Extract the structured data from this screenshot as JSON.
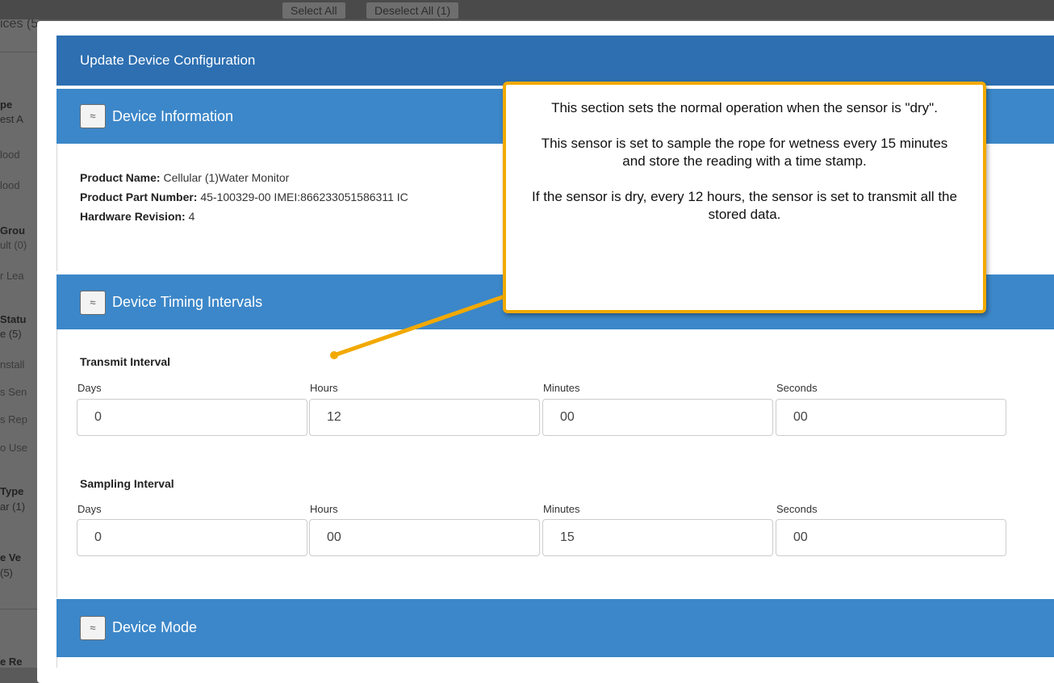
{
  "background": {
    "page_title_fragment": "ices (5)",
    "toolbar": {
      "select_all": "Select All",
      "deselect_all": "Deselect All (1)"
    },
    "sidebar_fragments": [
      {
        "text": "pe",
        "style": "bold"
      },
      {
        "text": "est A",
        "style": "normal"
      },
      {
        "text": "lood",
        "style": "dim"
      },
      {
        "text": "lood",
        "style": "dim"
      },
      {
        "text": "Grou",
        "style": "bold"
      },
      {
        "text": "ult (0)",
        "style": "dim"
      },
      {
        "text": "r Lea",
        "style": "dim"
      },
      {
        "text": "Statu",
        "style": "bold"
      },
      {
        "text": "e (5)",
        "style": "normal"
      },
      {
        "text": "nstall",
        "style": "dim"
      },
      {
        "text": "s Sen",
        "style": "dim"
      },
      {
        "text": "s Rep",
        "style": "dim"
      },
      {
        "text": "o Use",
        "style": "dim"
      },
      {
        "text": "Type",
        "style": "bold"
      },
      {
        "text": "ar (1)",
        "style": "normal"
      },
      {
        "text": "e Ve",
        "style": "bold"
      },
      {
        "text": "(5)",
        "style": "normal"
      },
      {
        "text": "e Re",
        "style": "bold"
      }
    ]
  },
  "modal": {
    "title": "Update Device Configuration",
    "toggle_glyph": "≈",
    "sections": {
      "device_information": {
        "title": "Device Information",
        "product_name_label": "Product Name:",
        "product_name_value": "Cellular (1)Water Monitor",
        "part_number_label": "Product Part Number:",
        "part_number_value": "45-100329-00 IMEI:866233051586311 IC",
        "hardware_revision_label": "Hardware Revision:",
        "hardware_revision_value": "4"
      },
      "timing_intervals": {
        "title": "Device Timing Intervals",
        "transmit": {
          "label": "Transmit Interval",
          "days_label": "Days",
          "days": "0",
          "hours_label": "Hours",
          "hours": "12",
          "minutes_label": "Minutes",
          "minutes": "00",
          "seconds_label": "Seconds",
          "seconds": "00"
        },
        "sampling": {
          "label": "Sampling Interval",
          "days_label": "Days",
          "days": "0",
          "hours_label": "Hours",
          "hours": "00",
          "minutes_label": "Minutes",
          "minutes": "15",
          "seconds_label": "Seconds",
          "seconds": "00"
        }
      },
      "device_mode": {
        "title": "Device Mode"
      }
    }
  },
  "callout": {
    "line1": "This section sets the normal operation when the sensor is \"dry\".",
    "line2": "This sensor is set to sample the rope for wetness every 15 minutes and store the reading with a time stamp.",
    "line3": "If the sensor is dry, every 12 hours, the sensor is set to transmit all the stored data.",
    "accent_color": "#f2a900"
  },
  "colors": {
    "modal_header": "#2d6fb1",
    "section_header": "#3c87c9"
  }
}
